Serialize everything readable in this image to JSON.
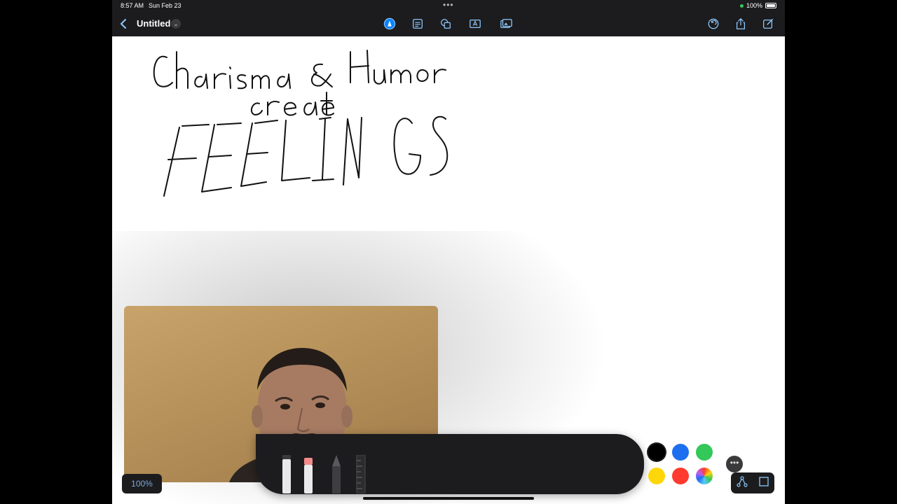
{
  "status_bar": {
    "time": "8:57 AM",
    "date": "Sun Feb 23",
    "battery": "100%"
  },
  "toolbar": {
    "title": "Untitled",
    "title_chevron": "⌄",
    "icons": [
      "back-chevron-icon",
      "pen-tool-icon",
      "text-box-icon",
      "shapes-icon",
      "text-icon",
      "media-icon",
      "undo-icon",
      "share-icon",
      "edit-icon"
    ]
  },
  "canvas": {
    "handwriting_lines": [
      "Charisma & Humor",
      "create",
      "FEELINGS"
    ]
  },
  "palette": {
    "colors": [
      {
        "name": "black",
        "hex": "#000000"
      },
      {
        "name": "blue",
        "hex": "#1e6ff0"
      },
      {
        "name": "green",
        "hex": "#34c759"
      },
      {
        "name": "yellow",
        "hex": "#ffd60a"
      },
      {
        "name": "red",
        "hex": "#ff3b30"
      },
      {
        "name": "multicolor",
        "hex": "conic"
      }
    ],
    "more_label": "•••"
  },
  "zoom": "100%"
}
